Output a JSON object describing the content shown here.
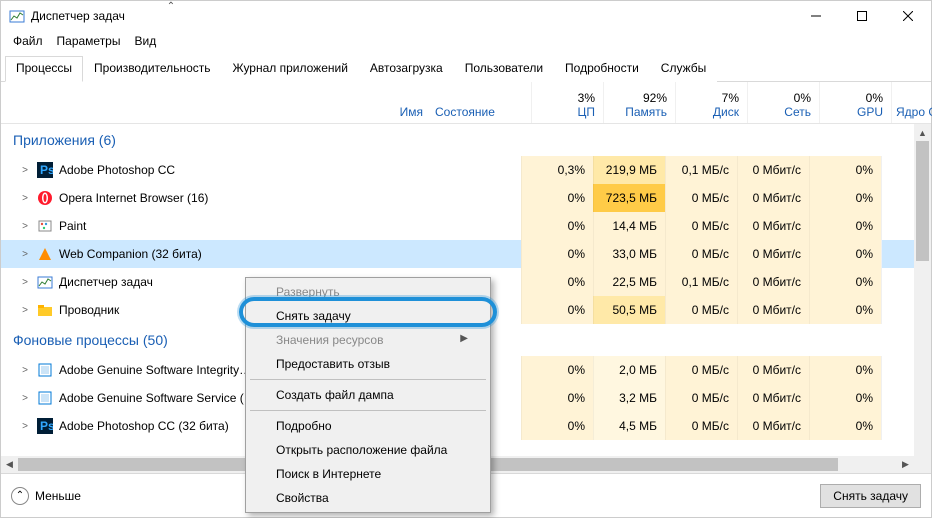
{
  "window": {
    "title": "Диспетчер задач"
  },
  "menu": {
    "file": "Файл",
    "options": "Параметры",
    "view": "Вид"
  },
  "tabs": [
    "Процессы",
    "Производительность",
    "Журнал приложений",
    "Автозагрузка",
    "Пользователи",
    "Подробности",
    "Службы"
  ],
  "activeTab": 0,
  "columns": {
    "name": "Имя",
    "state": "Состояние",
    "cpu": {
      "pct": "3%",
      "lbl": "ЦП"
    },
    "mem": {
      "pct": "92%",
      "lbl": "Память"
    },
    "disk": {
      "pct": "7%",
      "lbl": "Диск"
    },
    "net": {
      "pct": "0%",
      "lbl": "Сеть"
    },
    "gpu": {
      "pct": "0%",
      "lbl": "GPU"
    },
    "gpucore": {
      "pct": "",
      "lbl": "Ядро GPU"
    }
  },
  "groups": {
    "apps": {
      "title": "Приложения (6)"
    },
    "bg": {
      "title": "Фоновые процессы (50)"
    }
  },
  "rows": [
    {
      "group": "apps",
      "expand": ">",
      "icon": "ps",
      "name": "Adobe Photoshop CC",
      "cpu": "0,3%",
      "mem": "219,9 МБ",
      "disk": "0,1 МБ/с",
      "net": "0 Мбит/с",
      "gpu": "0%",
      "memHeat": "heat-mem0",
      "cpuHeat": "heat-cpu1"
    },
    {
      "group": "apps",
      "expand": ">",
      "icon": "opera",
      "name": "Opera Internet Browser (16)",
      "cpu": "0%",
      "mem": "723,5 МБ",
      "disk": "0 МБ/с",
      "net": "0 Мбит/с",
      "gpu": "0%",
      "memHeat": "heat-mem1"
    },
    {
      "group": "apps",
      "expand": ">",
      "icon": "paint",
      "name": "Paint",
      "cpu": "0%",
      "mem": "14,4 МБ",
      "disk": "0 МБ/с",
      "net": "0 Мбит/с",
      "gpu": "0%",
      "memHeat": "heat-mem2"
    },
    {
      "group": "apps",
      "expand": ">",
      "icon": "wc",
      "name": "Web Companion (32 бита)",
      "cpu": "0%",
      "mem": "33,0 МБ",
      "disk": "0 МБ/с",
      "net": "0 Мбит/с",
      "gpu": "0%",
      "memHeat": "heat-mem2",
      "selected": true
    },
    {
      "group": "apps",
      "expand": ">",
      "icon": "tm",
      "name": "Диспетчер задач",
      "cpu": "0%",
      "mem": "22,5 МБ",
      "disk": "0,1 МБ/с",
      "net": "0 Мбит/с",
      "gpu": "0%",
      "memHeat": "heat-mem2"
    },
    {
      "group": "apps",
      "expand": ">",
      "icon": "explorer",
      "name": "Проводник",
      "cpu": "0%",
      "mem": "50,5 МБ",
      "disk": "0 МБ/с",
      "net": "0 Мбит/с",
      "gpu": "0%",
      "memHeat": "heat-mem0"
    },
    {
      "group": "bg",
      "expand": ">",
      "icon": "adobe",
      "name": "Adobe Genuine Software Integrity…",
      "cpu": "0%",
      "mem": "2,0 МБ",
      "disk": "0 МБ/с",
      "net": "0 Мбит/с",
      "gpu": "0%",
      "memHeat": "heat-mem3"
    },
    {
      "group": "bg",
      "expand": ">",
      "icon": "adobe",
      "name": "Adobe Genuine Software Service (…",
      "cpu": "0%",
      "mem": "3,2 МБ",
      "disk": "0 МБ/с",
      "net": "0 Мбит/с",
      "gpu": "0%",
      "memHeat": "heat-mem3"
    },
    {
      "group": "bg",
      "expand": ">",
      "icon": "ps",
      "name": "Adobe Photoshop CC (32 бита)",
      "cpu": "0%",
      "mem": "4,5 МБ",
      "disk": "0 МБ/с",
      "net": "0 Мбит/с",
      "gpu": "0%",
      "memHeat": "heat-mem3"
    }
  ],
  "contextMenu": {
    "items": [
      {
        "label": "Развернуть",
        "disabled": true
      },
      {
        "label": "Снять задачу",
        "highlighted": true
      },
      {
        "label": "Значения ресурсов",
        "submenu": true,
        "disabled": true
      },
      {
        "label": "Предоставить отзыв"
      },
      {
        "sep": true
      },
      {
        "label": "Создать файл дампа"
      },
      {
        "sep": true
      },
      {
        "label": "Подробно"
      },
      {
        "label": "Открыть расположение файла"
      },
      {
        "label": "Поиск в Интернете"
      },
      {
        "label": "Свойства"
      }
    ]
  },
  "footer": {
    "fewer": "Меньше",
    "endtask": "Снять задачу"
  }
}
